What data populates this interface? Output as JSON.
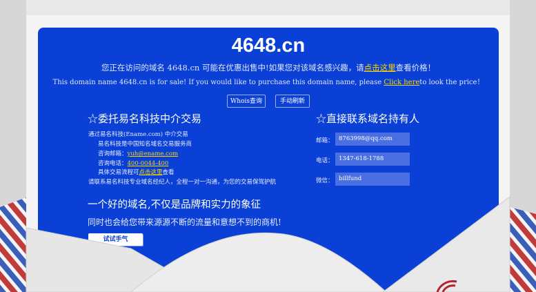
{
  "title": "4648.cn",
  "notice": {
    "cn_prefix": "您正在访问的域名 4648.cn 可能在优惠出售中!如果您对该域名感兴趣，请",
    "cn_link": "点击这里",
    "cn_suffix": "查看价格！",
    "en_prefix": "This domain name 4648.cn is for sale! If you would like to purchase this domain name, please ",
    "en_link": "Click here",
    "en_suffix": "to look the price！"
  },
  "buttons": {
    "whois": "Whois查询",
    "refresh": "手动刷新",
    "try": "试试手气"
  },
  "agent": {
    "heading": "☆委托易名科技中介交易",
    "line1": "通过易名科技(Ename.com) 中介交易",
    "line2": "易名科技是中国知名域名交易服务商",
    "email_label": "咨询邮箱：",
    "email_value": "yuh@ename.com",
    "phone_label": "咨询电话：",
    "phone_value": "400-0044-400",
    "process_prefix": "具体交易流程可",
    "process_link": "点击这里",
    "process_suffix": "查看",
    "line_last": "请联系易名科技专业域名经纪人，全程一对一沟通，为您的交易保驾护航"
  },
  "owner": {
    "heading": "☆直接联系域名持有人",
    "email_label": "邮箱：",
    "email_value": "8763998@qq.com",
    "phone_label": "电话：",
    "phone_value": "1347-618-1788",
    "wechat_label": "微信：",
    "wechat_value": "billfund"
  },
  "slogan": {
    "line1": "一个好的域名,不仅是品牌和实力的象征",
    "line2": "同时也会给您带来源源不断的流量和意想不到的商机!"
  },
  "colors": {
    "card": "#0a40d6",
    "link": "#ffd700",
    "background": "#e9e9e9"
  }
}
